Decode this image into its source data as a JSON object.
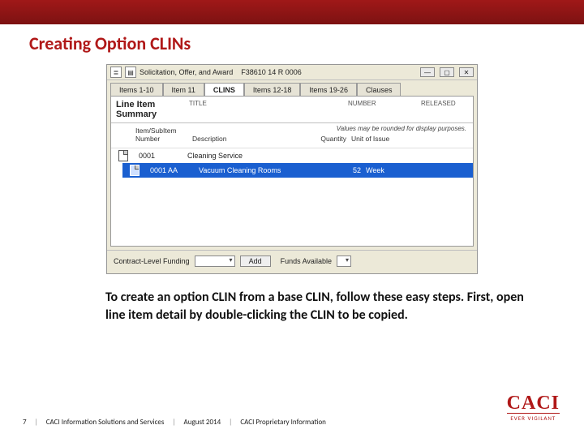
{
  "slide": {
    "title": "Creating Option CLINs",
    "body": "To create an option CLIN from a base CLIN, follow these easy steps.  First, open line item detail by double-clicking the CLIN to be copied."
  },
  "app": {
    "toolbar": {
      "doc_label": "Solicitation, Offer, and Award",
      "doc_number": "F38610 14 R 0006"
    },
    "winbuttons": {
      "min": "—",
      "max": "▢",
      "close": "✕"
    },
    "tabs": [
      {
        "label": "Items 1-10",
        "active": false
      },
      {
        "label": "Item 11",
        "active": false
      },
      {
        "label": "CLINS",
        "active": true
      },
      {
        "label": "Items 12-18",
        "active": false
      },
      {
        "label": "Items 19-26",
        "active": false
      },
      {
        "label": "Clauses",
        "active": false
      }
    ],
    "clins": {
      "panel_title_l1": "Line Item",
      "panel_title_l2": "Summary",
      "col_title": "TITLE",
      "col_number": "NUMBER",
      "col_released": "RELEASED",
      "sub_col_number_l1": "Item/SubItem",
      "sub_col_number_l2": "Number",
      "sub_col_desc": "Description",
      "sub_col_qty": "Quantity",
      "sub_col_uoi": "Unit of Issue",
      "rounding_note": "Values may be rounded for display purposes.",
      "rows": [
        {
          "num": "0001",
          "desc": "Cleaning Service",
          "qty": "",
          "uoi": "",
          "selected": false
        },
        {
          "num": "0001 AA",
          "desc": "Vacuum Cleaning Rooms",
          "qty": "52",
          "uoi": "Week",
          "selected": true
        }
      ]
    },
    "bottom": {
      "contract_label": "Contract-Level Funding",
      "add_label": "Add",
      "funds_label": "Funds Available"
    }
  },
  "footer": {
    "page": "7",
    "org": "CACI Information Solutions and Services",
    "date": "August 2014",
    "class": "CACI Proprietary Information"
  },
  "logo": {
    "brand": "CACI",
    "tagline": "EVER VIGILANT"
  }
}
